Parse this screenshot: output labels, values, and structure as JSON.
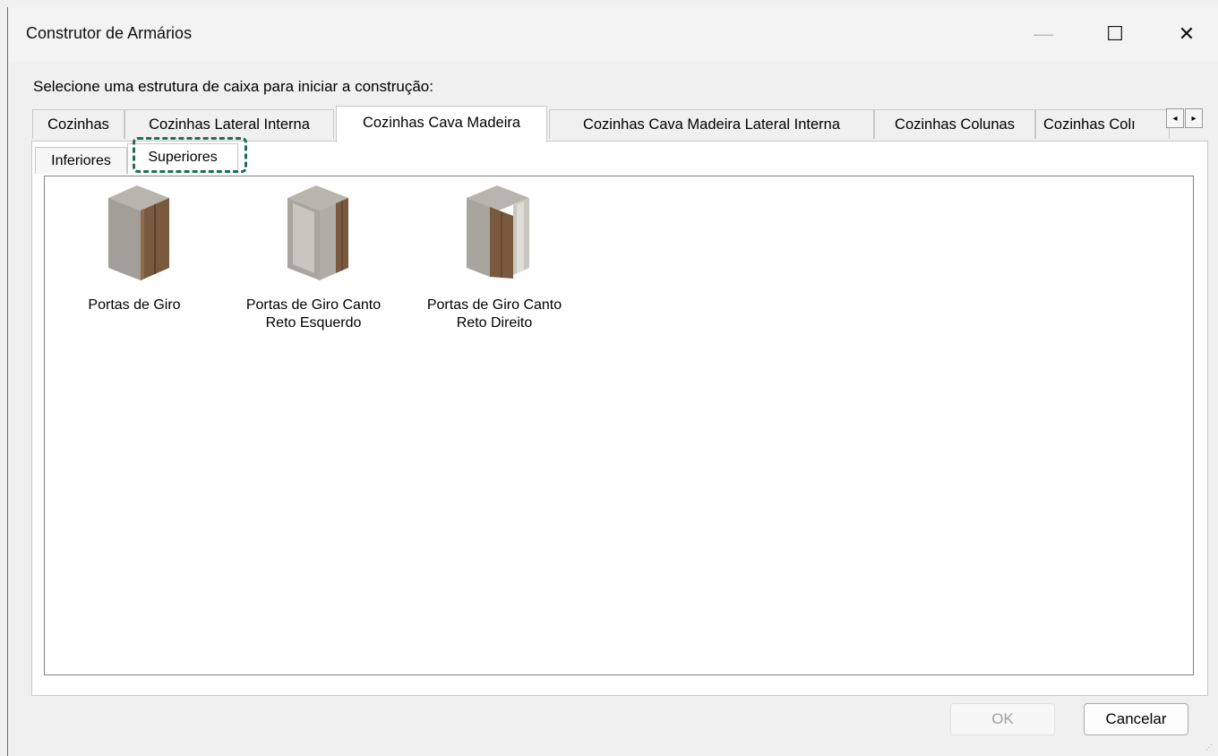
{
  "window": {
    "title": "Construtor de Armários",
    "minimize_glyph": "—",
    "maximize_glyph": "☐",
    "close_glyph": "✕"
  },
  "prompt": "Selecione uma estrutura de caixa para iniciar a construção:",
  "outer_tabs": [
    {
      "label": "Cozinhas"
    },
    {
      "label": "Cozinhas Lateral Interna"
    },
    {
      "label": "Cozinhas Cava Madeira"
    },
    {
      "label": "Cozinhas Cava Madeira Lateral Interna"
    },
    {
      "label": "Cozinhas Colunas"
    },
    {
      "label": "Cozinhas Colı"
    }
  ],
  "outer_tabs_active": "Cozinhas Cava Madeira",
  "tab_scroll": {
    "left": "◂",
    "right": "▸"
  },
  "inner_tabs": [
    {
      "label": "Inferiores"
    },
    {
      "label": "Superiores"
    }
  ],
  "inner_tabs_active": "Superiores",
  "items": [
    {
      "label_line1": "Portas de Giro",
      "label_line2": "",
      "icon": "cabinet-double-door-icon"
    },
    {
      "label_line1": "Portas de Giro Canto",
      "label_line2": "Reto Esquerdo",
      "icon": "cabinet-corner-left-icon"
    },
    {
      "label_line1": "Portas de Giro Canto",
      "label_line2": "Reto Direito",
      "icon": "cabinet-corner-right-icon"
    }
  ],
  "buttons": {
    "ok": "OK",
    "cancel": "Cancelar"
  },
  "colors": {
    "focus_ring": "#1f6e55",
    "wood": "#7a5a3e",
    "panel_gray": "#a8a49e"
  }
}
